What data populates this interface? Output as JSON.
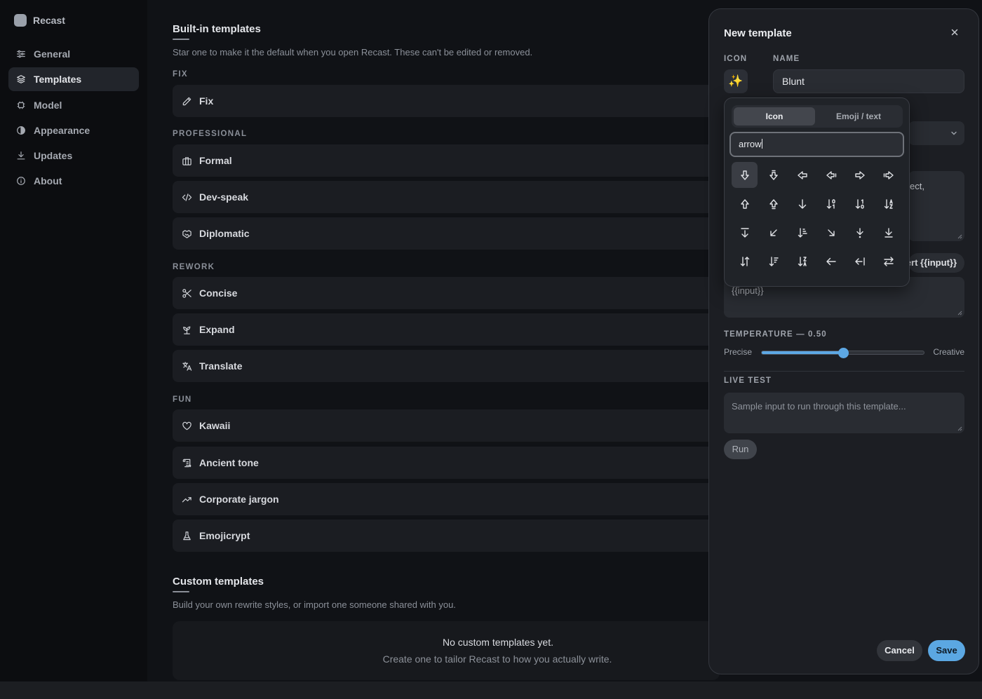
{
  "app": {
    "name": "Recast"
  },
  "sidebar": {
    "items": [
      {
        "label": "General",
        "icon": "sliders-icon"
      },
      {
        "label": "Templates",
        "icon": "layers-icon",
        "active": true
      },
      {
        "label": "Model",
        "icon": "chip-icon"
      },
      {
        "label": "Appearance",
        "icon": "contrast-icon"
      },
      {
        "label": "Updates",
        "icon": "download-icon"
      },
      {
        "label": "About",
        "icon": "info-icon"
      }
    ]
  },
  "builtin": {
    "title": "Built-in templates",
    "description": "Star one to make it the default when you open Recast. These can't be edited or removed.",
    "groups": [
      {
        "label": "FIX",
        "items": [
          {
            "label": "Fix",
            "icon": "pencil-icon"
          }
        ]
      },
      {
        "label": "PROFESSIONAL",
        "items": [
          {
            "label": "Formal",
            "icon": "briefcase-icon"
          },
          {
            "label": "Dev-speak",
            "icon": "code-icon"
          },
          {
            "label": "Diplomatic",
            "icon": "handshake-icon"
          }
        ]
      },
      {
        "label": "REWORK",
        "items": [
          {
            "label": "Concise",
            "icon": "scissors-icon"
          },
          {
            "label": "Expand",
            "icon": "sprout-icon"
          },
          {
            "label": "Translate",
            "icon": "languages-icon"
          }
        ]
      },
      {
        "label": "FUN",
        "items": [
          {
            "label": "Kawaii",
            "icon": "heart-icon"
          },
          {
            "label": "Ancient tone",
            "icon": "scroll-icon"
          },
          {
            "label": "Corporate jargon",
            "icon": "trending-up-icon"
          },
          {
            "label": "Emojicrypt",
            "icon": "flask-icon"
          }
        ]
      }
    ]
  },
  "custom": {
    "title": "Custom templates",
    "description": "Build your own rewrite styles, or import one someone shared with you.",
    "empty_title": "No custom templates yet.",
    "empty_subtitle": "Create one to tailor Recast to how you actually write."
  },
  "modal": {
    "title": "New template",
    "icon_label": "ICON",
    "name_label": "NAME",
    "icon_glyph": "✨",
    "name_value": "Blunt",
    "hidden_text_fragment": "ect,",
    "insert_button": "Insert {{input}}",
    "input_value": "{{input}}",
    "temperature_label": "TEMPERATURE — 0.50",
    "temperature_value": 0.5,
    "precise_label": "Precise",
    "creative_label": "Creative",
    "live_test_label": "LIVE TEST",
    "sample_placeholder": "Sample input to run through this template...",
    "run_button": "Run",
    "cancel_button": "Cancel",
    "save_button": "Save"
  },
  "picker": {
    "tab_icon": "Icon",
    "tab_emoji": "Emoji / text",
    "search_value": "arrow",
    "icons": [
      "arrow-big-down-icon",
      "arrow-big-down-dash-icon",
      "arrow-big-left-icon",
      "arrow-big-left-dash-icon",
      "arrow-big-right-icon",
      "arrow-big-right-dash-icon",
      "arrow-big-up-icon",
      "arrow-big-up-dash-icon",
      "arrow-down-icon",
      "arrow-down-0-1-icon",
      "arrow-down-1-0-icon",
      "arrow-down-a-z-icon",
      "arrow-down-from-line-icon",
      "arrow-down-left-icon",
      "arrow-down-narrow-wide-icon",
      "arrow-down-right-icon",
      "arrow-down-to-dot-icon",
      "arrow-down-to-line-icon",
      "arrow-down-up-icon",
      "arrow-down-wide-narrow-icon",
      "arrow-down-z-a-icon",
      "arrow-left-icon",
      "arrow-left-from-line-icon",
      "arrow-left-right-icon"
    ]
  },
  "colors": {
    "accent": "#5da8e4",
    "background": "#101216",
    "surface": "#1b1d22"
  }
}
